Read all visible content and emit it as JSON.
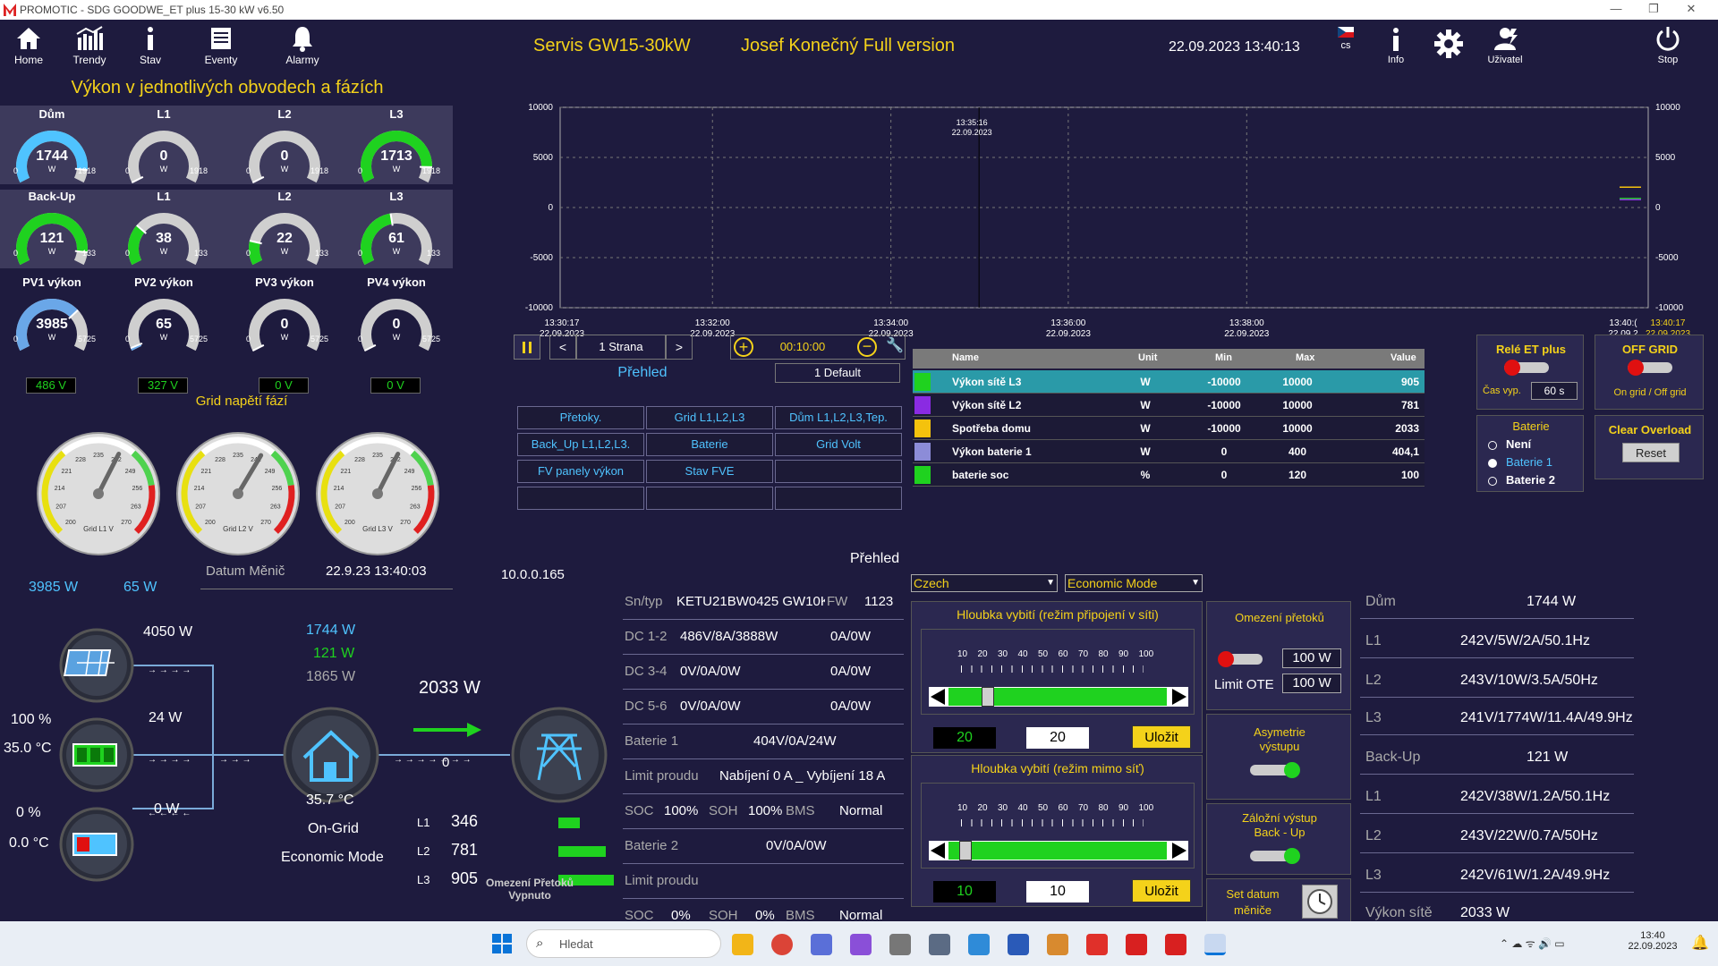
{
  "window": {
    "title": "PROMOTIC - SDG GOODWE_ET plus 15-30 kW  v6.50"
  },
  "nav": [
    {
      "label": "Home",
      "icon": "home-icon"
    },
    {
      "label": "Trendy",
      "icon": "chart-icon"
    },
    {
      "label": "Stav",
      "icon": "info-icon"
    },
    {
      "label": "Eventy",
      "icon": "events-icon"
    },
    {
      "label": "Alarmy",
      "icon": "bell-icon"
    }
  ],
  "header": {
    "service": "Servis GW15-30kW",
    "user_name": "Josef Konečný Full version",
    "datetime": "22.09.2023 13:40:13",
    "lang": "cs",
    "info": "Info",
    "user": "Uživatel",
    "stop": "Stop"
  },
  "left": {
    "title": "Výkon v jednotlivých obvodech a fázích",
    "row1": [
      {
        "label": "Dům",
        "value": "1744",
        "unit": "W",
        "min": "0",
        "max": "1918",
        "fraction": 0.91,
        "color": "#4fc3ff"
      },
      {
        "label": "L1",
        "value": "0",
        "unit": "W",
        "min": "0",
        "max": "1918",
        "fraction": 0.0,
        "color": "#cccccc"
      },
      {
        "label": "L2",
        "value": "0",
        "unit": "W",
        "min": "0",
        "max": "1918",
        "fraction": 0.0,
        "color": "#cccccc"
      },
      {
        "label": "L3",
        "value": "1713",
        "unit": "W",
        "min": "0",
        "max": "1918",
        "fraction": 0.89,
        "color": "#1fd21f"
      }
    ],
    "row2": [
      {
        "label": "Back-Up",
        "value": "121",
        "unit": "W",
        "min": "0",
        "max": "133",
        "fraction": 0.91,
        "color": "#1fd21f"
      },
      {
        "label": "L1",
        "value": "38",
        "unit": "W",
        "min": "0",
        "max": "133",
        "fraction": 0.29,
        "color": "#1fd21f"
      },
      {
        "label": "L2",
        "value": "22",
        "unit": "W",
        "min": "0",
        "max": "133",
        "fraction": 0.17,
        "color": "#1fd21f"
      },
      {
        "label": "L3",
        "value": "61",
        "unit": "W",
        "min": "0",
        "max": "133",
        "fraction": 0.46,
        "color": "#1fd21f"
      }
    ],
    "row3": [
      {
        "label": "PV1 výkon",
        "value": "3985",
        "unit": "W",
        "min": "0",
        "max": "5725",
        "fraction": 0.7,
        "color": "#6aa7e8",
        "volt": "486 V"
      },
      {
        "label": "PV2 výkon",
        "value": "65",
        "unit": "W",
        "min": "0",
        "max": "5725",
        "fraction": 0.02,
        "color": "#6aa7e8",
        "volt": "327 V"
      },
      {
        "label": "PV3 výkon",
        "value": "0",
        "unit": "W",
        "min": "0",
        "max": "5725",
        "fraction": 0.0,
        "color": "#cccccc",
        "volt": "0 V"
      },
      {
        "label": "PV4 výkon",
        "value": "0",
        "unit": "W",
        "min": "0",
        "max": "5725",
        "fraction": 0.0,
        "color": "#cccccc",
        "volt": "0 V"
      }
    ],
    "grid_title": "Grid napětí fází",
    "grid_gauges": [
      {
        "label": "Grid L1 V",
        "value": 242
      },
      {
        "label": "Grid L2 V",
        "value": 243
      },
      {
        "label": "Grid L3 V",
        "value": 242
      }
    ],
    "grid_ticks": [
      "200",
      "207",
      "214",
      "221",
      "228",
      "235",
      "242",
      "249",
      "256",
      "263",
      "270"
    ]
  },
  "trend": {
    "y_ticks": [
      "10000",
      "5000",
      "0",
      "-5000",
      "-10000"
    ],
    "cursor_time": "13:35:16",
    "cursor_date": "22.09.2023",
    "x_ticks": [
      {
        "t": "13:30:17",
        "d": "22.09.2023"
      },
      {
        "t": "13:32:00",
        "d": "22.09.2023"
      },
      {
        "t": "13:34:00",
        "d": "22.09.2023"
      },
      {
        "t": "13:36:00",
        "d": "22.09.2023"
      },
      {
        "t": "13:38:00",
        "d": "22.09.2023"
      },
      {
        "t": "13:40:(",
        "d": "22.09.2"
      },
      {
        "t": "13:40:17",
        "d": "22.09.2023"
      }
    ]
  },
  "trend_controls": {
    "page": "1 Strana",
    "prev": "<",
    "next": ">",
    "interval": "00:10:00",
    "preset": "1 Default",
    "overview": "Přehled",
    "buttons": [
      [
        "Přetoky.",
        "Grid  L1,L2,L3",
        "Dům L1,L2,L3,Tep."
      ],
      [
        "Back_Up L1,L2,L3.",
        "Baterie",
        "Grid Volt"
      ],
      [
        "FV panely výkon",
        "Stav FVE",
        ""
      ],
      [
        "",
        "",
        ""
      ]
    ]
  },
  "legend_table": {
    "headers": [
      "Name",
      "Unit",
      "Min",
      "Max",
      "Value"
    ],
    "rows": [
      {
        "color": "#1fd21f",
        "name": "Výkon sítě L3",
        "unit": "W",
        "min": "-10000",
        "max": "10000",
        "value": "905",
        "selected": true
      },
      {
        "color": "#8a2be2",
        "name": "Výkon sítě L2",
        "unit": "W",
        "min": "-10000",
        "max": "10000",
        "value": "781"
      },
      {
        "color": "#f4c20d",
        "name": "Spotřeba domu",
        "unit": "W",
        "min": "-10000",
        "max": "10000",
        "value": "2033"
      },
      {
        "color": "#8c8cd8",
        "name": "Výkon baterie 1",
        "unit": "W",
        "min": "0",
        "max": "400",
        "value": "404,1"
      },
      {
        "color": "#1fd21f",
        "name": "baterie soc",
        "unit": "%",
        "min": "0",
        "max": "120",
        "value": "100"
      }
    ]
  },
  "right_panel": {
    "rele_title": "Relé ET plus",
    "cas_label": "Čas vyp.",
    "cas_value": "60 s",
    "offgrid_title": "OFF GRID",
    "offgrid_sub": "On grid / Off grid",
    "bat_title": "Baterie",
    "bat_options": [
      "Není",
      "Baterie 1",
      "Baterie 2"
    ],
    "clear_title": "Clear Overload",
    "reset": "Reset"
  },
  "flow": {
    "pv1": "3985 W",
    "pv2": "65 W",
    "pv_power": "4050 W",
    "bat_soc": "100 %",
    "bat_temp": "35.0 °C",
    "bat_power": "24 W",
    "bat2_soc": "0 %",
    "bat2_temp": "0.0 °C",
    "bat2_power": "0 W",
    "house1": "1744 W",
    "house2": "121 W",
    "house3": "1865 W",
    "grid_power": "2033 W",
    "zero": "0",
    "inv_temp": "35.7 °C",
    "status": "On-Grid",
    "mode": "Economic Mode",
    "phases": [
      {
        "l": "L1",
        "v": "346",
        "f": 0.38
      },
      {
        "l": "L2",
        "v": "781",
        "f": 0.86
      },
      {
        "l": "L3",
        "v": "905",
        "f": 1.0
      }
    ],
    "limit_label": "Omezení Přetoků Vypnuto",
    "datum_label": "Datum Měnič",
    "datum_value": "22.9.23 13:40:03",
    "ip": "10.0.0.165"
  },
  "info": {
    "overview": "Přehled",
    "sn_label": "Sn/typ",
    "sn_value": "KETU21BW0425 GW10K",
    "fw_label": "FW",
    "fw_value": "1123",
    "dc12_label": "DC 1-2",
    "dc12": "486V/8A/3888W",
    "dc12b": "0A/0W",
    "dc34_label": "DC 3-4",
    "dc34": "0V/0A/0W",
    "dc34b": "0A/0W",
    "dc56_label": "DC 5-6",
    "dc56": "0V/0A/0W",
    "dc56b": "0A/0W",
    "bat1_label": "Baterie 1",
    "bat1": "404V/0A/24W",
    "limit1_label": "Limit proudu",
    "limit1": "Nabíjení 0 A _ Vybíjení 18 A",
    "soc_label": "SOC",
    "soc1": "100%",
    "soh_label": "SOH",
    "soh1": "100%",
    "bms_label": "BMS",
    "bms1": "Normal",
    "bat2_label": "Baterie 2",
    "bat2": "0V/0A/0W",
    "limit2_label": "Limit proudu",
    "soc2": "0%",
    "soh2": "0%",
    "bms2": "Normal"
  },
  "controls": {
    "lang_select": "Czech",
    "mode_select": "Economic Mode",
    "depth_on_title": "Hloubka vybití (režim připojení v síti)",
    "depth_off_title": "Hloubka  vybití  (režim mimo síť)",
    "scale": [
      "10",
      "20",
      "30",
      "40",
      "50",
      "60",
      "70",
      "80",
      "90",
      "100"
    ],
    "depth_on_value": "20",
    "depth_on_input": "20",
    "depth_on_fraction": 0.2,
    "depth_off_value": "10",
    "depth_off_input": "10",
    "depth_off_fraction": 0.1,
    "save": "Uložit",
    "omezeni_title": "Omezení přetoků",
    "omezeni_value": "100 W",
    "limit_ote_label": "Limit OTE",
    "limit_ote_value": "100 W",
    "asym_title": "Asymetrie výstupu",
    "backup_title": "Záložní výstup Back - Up",
    "set_date_title": "Set datum měniče"
  },
  "summary": [
    {
      "label": "Dům",
      "value": "1744 W"
    },
    {
      "label": "L1",
      "value": "242V/5W/2A/50.1Hz"
    },
    {
      "label": "L2",
      "value": "243V/10W/3.5A/50Hz"
    },
    {
      "label": "L3",
      "value": "241V/1774W/11.4A/49.9Hz"
    },
    {
      "label": "Back-Up",
      "value": "121 W"
    },
    {
      "label": "L1",
      "value": "242V/38W/1.2A/50.1Hz"
    },
    {
      "label": "L2",
      "value": "243V/22W/0.7A/50Hz"
    },
    {
      "label": "L3",
      "value": "242V/61W/1.2A/49.9Hz"
    },
    {
      "label": "Výkon sítě",
      "value": "2033 W"
    }
  ],
  "taskbar": {
    "search": "Hledat",
    "time": "13:40",
    "date": "22.09.2023"
  }
}
